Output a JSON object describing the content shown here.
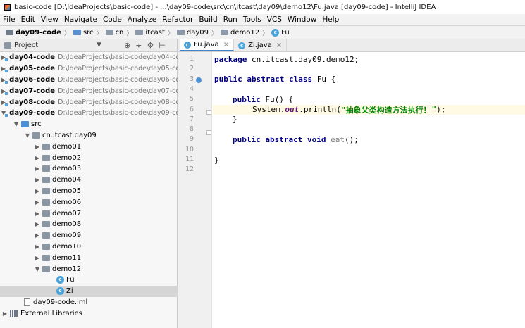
{
  "window": {
    "title": "basic-code [D:\\IdeaProjects\\basic-code] - ...\\day09-code\\src\\cn\\itcast\\day09\\demo12\\Fu.java [day09-code] - IntelliJ IDEA"
  },
  "menu": [
    "File",
    "Edit",
    "View",
    "Navigate",
    "Code",
    "Analyze",
    "Refactor",
    "Build",
    "Run",
    "Tools",
    "VCS",
    "Window",
    "Help"
  ],
  "breadcrumb": [
    "day09-code",
    "src",
    "cn",
    "itcast",
    "day09",
    "demo12",
    "Fu"
  ],
  "project_panel": {
    "title": "Project",
    "modules": [
      {
        "name": "day04-code",
        "path": "D:\\IdeaProjects\\basic-code\\day04-co"
      },
      {
        "name": "day05-code",
        "path": "D:\\IdeaProjects\\basic-code\\day05-co"
      },
      {
        "name": "day06-code",
        "path": "D:\\IdeaProjects\\basic-code\\day06-co"
      },
      {
        "name": "day07-code",
        "path": "D:\\IdeaProjects\\basic-code\\day07-co"
      },
      {
        "name": "day08-code",
        "path": "D:\\IdeaProjects\\basic-code\\day08-co"
      },
      {
        "name": "day09-code",
        "path": "D:\\IdeaProjects\\basic-code\\day09-co"
      }
    ],
    "src": "src",
    "package": "cn.itcast.day09",
    "packages": [
      "demo01",
      "demo02",
      "demo03",
      "demo04",
      "demo05",
      "demo06",
      "demo07",
      "demo08",
      "demo09",
      "demo10",
      "demo11",
      "demo12"
    ],
    "classes": [
      "Fu",
      "Zi"
    ],
    "iml": "day09-code.iml",
    "external": "External Libraries"
  },
  "tabs": [
    {
      "label": "Fu.java",
      "active": true
    },
    {
      "label": "Zi.java",
      "active": false
    }
  ],
  "code": {
    "line_numbers": [
      "1",
      "2",
      "3",
      "4",
      "5",
      "6",
      "7",
      "8",
      "9",
      "10",
      "11",
      "12"
    ],
    "l1_kw": "package",
    "l1_rest": " cn.itcast.day09.demo12;",
    "l3_kw": "public abstract class",
    "l3_rest": " Fu {",
    "l5_kw": "public",
    "l5_rest": " Fu() {",
    "l6_a": "System.",
    "l6_field": "out",
    "l6_b": ".println(",
    "l6_str": "\"抽象父类构造方法执行！",
    "l6_str_end": "\"",
    "l6_c": ");",
    "l7": "}",
    "l9_kw": "public abstract void",
    "l9_method": " eat",
    "l9_rest": "();",
    "l11": "}"
  }
}
